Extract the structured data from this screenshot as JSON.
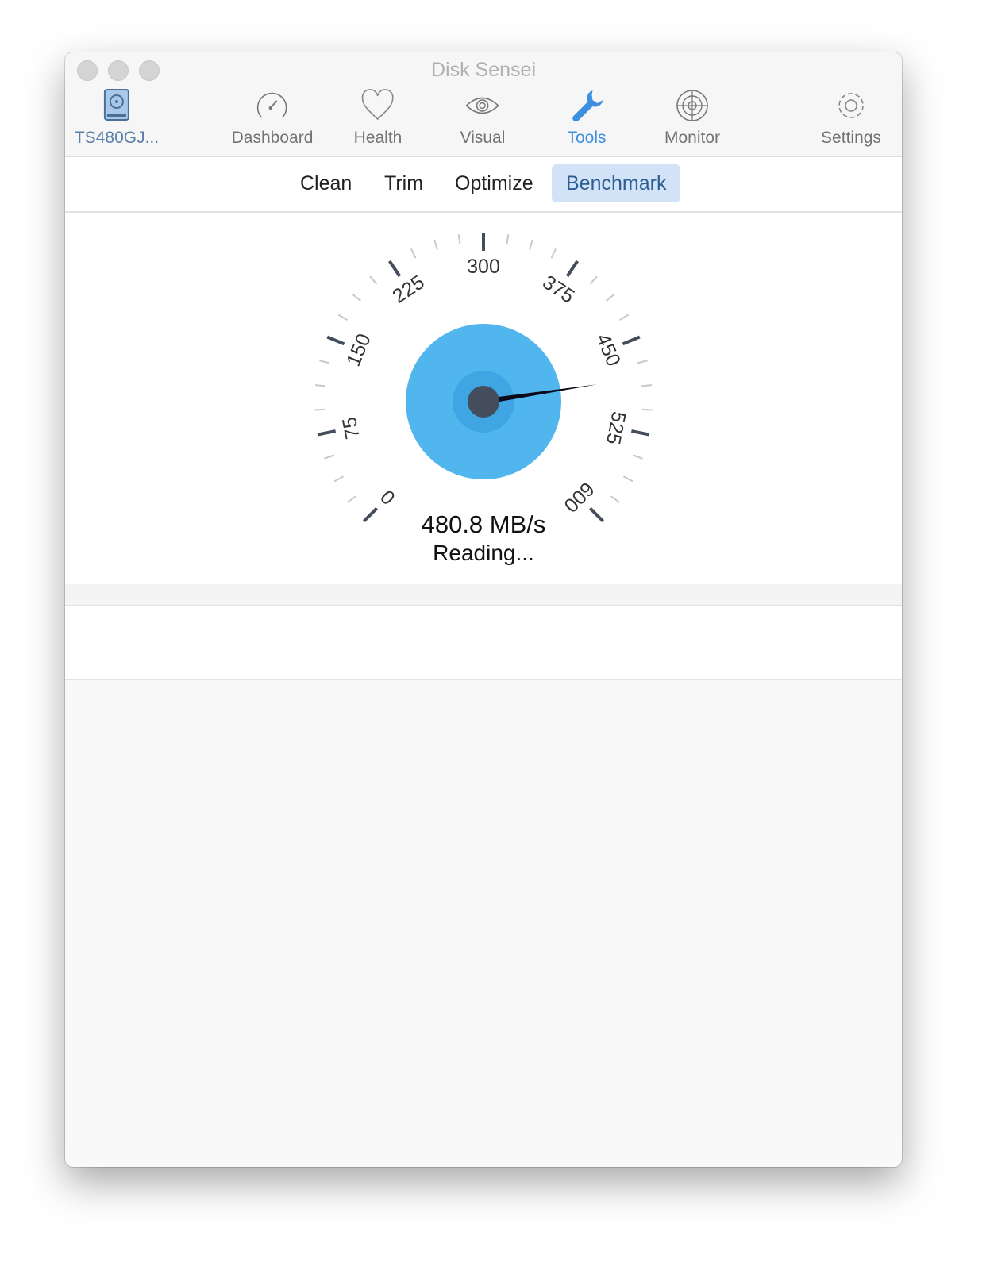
{
  "window": {
    "title": "Disk Sensei"
  },
  "toolbar": {
    "items": [
      {
        "label": "TS480GJ...",
        "icon": "hard-drive-icon"
      },
      {
        "label": "Dashboard",
        "icon": "speedometer-icon"
      },
      {
        "label": "Health",
        "icon": "heart-icon"
      },
      {
        "label": "Visual",
        "icon": "eye-icon"
      },
      {
        "label": "Tools",
        "icon": "wrench-icon",
        "active": true
      },
      {
        "label": "Monitor",
        "icon": "radar-icon"
      },
      {
        "label": "Settings",
        "icon": "gear-icon"
      }
    ]
  },
  "tabs": [
    {
      "label": "Clean"
    },
    {
      "label": "Trim"
    },
    {
      "label": "Optimize"
    },
    {
      "label": "Benchmark",
      "active": true
    }
  ],
  "gauge": {
    "min": 0,
    "max": 600,
    "tick_labels": [
      "0",
      "75",
      "150",
      "225",
      "300",
      "375",
      "450",
      "525",
      "600"
    ],
    "value": 480.8,
    "speed_text": "480.8 MB/s",
    "status_text": "Reading...",
    "colors": {
      "dial": "#52b6ee",
      "hub_ring": "#3fa6e3",
      "hub": "#434d5c",
      "needle": "#0a0a1a",
      "accent": "#3d8fe0"
    }
  }
}
